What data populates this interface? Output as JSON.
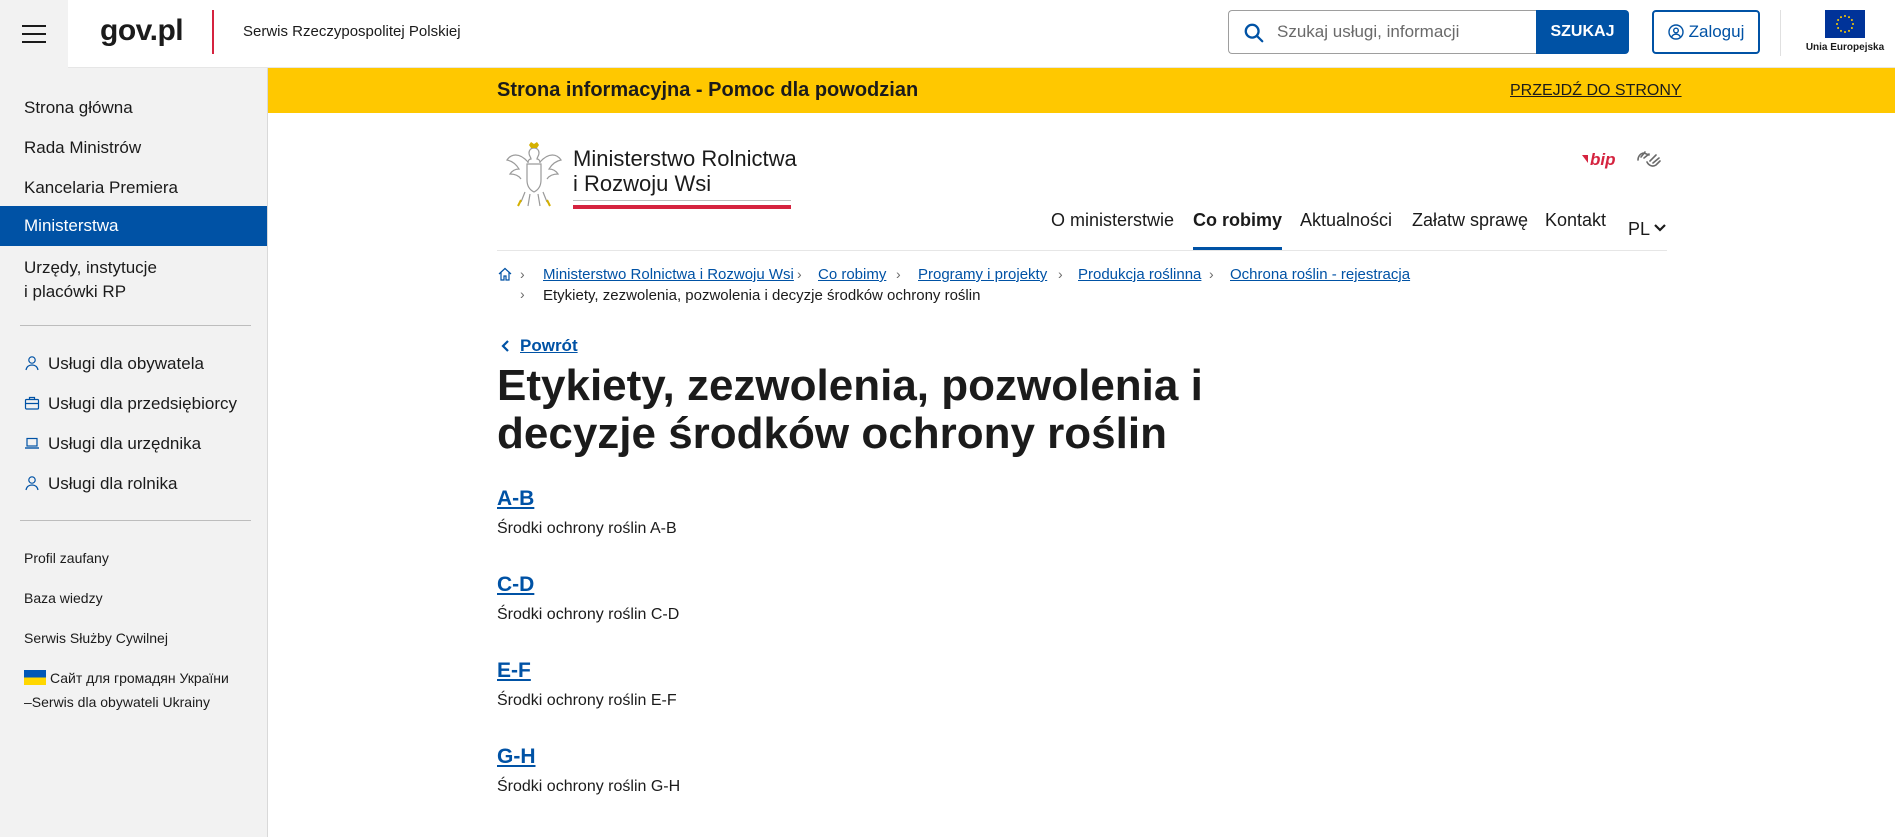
{
  "topbar": {
    "logo": "gov.pl",
    "service_name": "Serwis Rzeczypospolitej Polskiej",
    "search_placeholder": "Szukaj usługi, informacji",
    "search_button": "SZUKAJ",
    "login_button": "Zaloguj",
    "eu_label": "Unia Europejska"
  },
  "sidebar": {
    "main_items": [
      "Strona główna",
      "Rada Ministrów",
      "Kancelaria Premiera",
      "Ministerstwa"
    ],
    "urzedy_line1": "Urzędy, instytucje",
    "urzedy_line2": "i placówki RP",
    "services": [
      "Usługi dla obywatela",
      "Usługi dla przedsiębiorcy",
      "Usługi dla urzędnika",
      "Usługi dla rolnika"
    ],
    "extra": [
      "Profil zaufany",
      "Baza wiedzy",
      "Serwis Służby Cywilnej"
    ],
    "ukraine_line1": "Сайт для громадян України",
    "ukraine_line2": "–Serwis dla obywateli Ukrainy"
  },
  "banner": {
    "title": "Strona informacyjna - Pomoc dla powodzian",
    "link": "PRZEJDŹ DO STRONY"
  },
  "ministry": {
    "name_line1": "Ministerstwo Rolnictwa",
    "name_line2": "i Rozwoju Wsi",
    "bip": "bip"
  },
  "nav": {
    "items": [
      "O ministerstwie",
      "Co robimy",
      "Aktualności",
      "Załatw sprawę",
      "Kontakt"
    ],
    "lang": "PL"
  },
  "breadcrumb": {
    "links": [
      "Ministerstwo Rolnictwa i Rozwoju Wsi",
      "Co robimy",
      "Programy i projekty",
      "Produkcja roślinna",
      "Ochrona roślin - rejestracja"
    ],
    "current": "Etykiety, zezwolenia, pozwolenia i decyzje środków ochrony roślin"
  },
  "content": {
    "back": "Powrót",
    "title": "Etykiety, zezwolenia, pozwolenia i decyzje środków ochrony roślin",
    "entries": [
      {
        "link": "A-B",
        "desc": "Środki ochrony roślin A-B"
      },
      {
        "link": "C-D",
        "desc": "Środki ochrony roślin C-D"
      },
      {
        "link": "E-F",
        "desc": "Środki ochrony roślin E-F"
      },
      {
        "link": "G-H",
        "desc": "Środki ochrony roślin G-H"
      }
    ]
  },
  "colors": {
    "brand_blue": "#0052a5",
    "banner_yellow": "#ffc800",
    "accent_red": "#d5233f"
  }
}
